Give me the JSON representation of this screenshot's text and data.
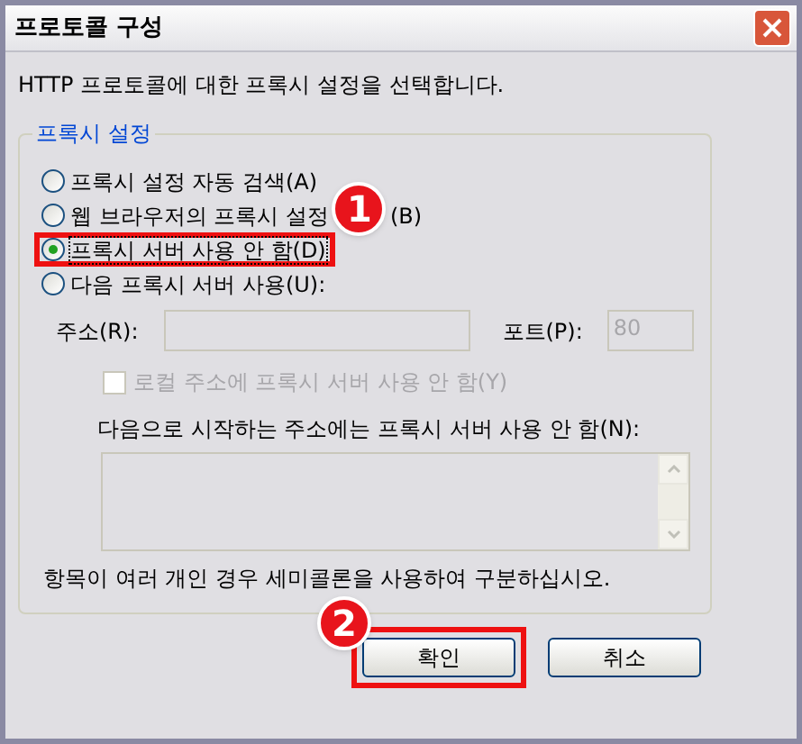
{
  "window": {
    "title": "프로토콜 구성"
  },
  "description": "HTTP 프로토콜에 대한 프록시 설정을 선택합니다.",
  "group": {
    "title": "프록시 설정",
    "options": [
      {
        "label": "프록시 설정 자동 검색(A)",
        "selected": false,
        "highlighted": false
      },
      {
        "label": "웹 브라우저의 프록시 설정",
        "suffix": "(B)",
        "badge": "1",
        "selected": false,
        "highlighted": false
      },
      {
        "label": "프록시 서버 사용 안 함(D)",
        "selected": true,
        "highlighted": true
      },
      {
        "label": "다음 프록시 서버 사용(U):",
        "selected": false,
        "highlighted": false
      }
    ],
    "address": {
      "label": "주소(R):",
      "disabled": true
    },
    "port": {
      "label": "포트(P):",
      "value": "80",
      "disabled": true
    },
    "bypass_local": {
      "label": "로컬 주소에 프록시 서버 사용 안 함(Y)",
      "checked": false,
      "disabled": true
    },
    "exceptions": {
      "label": "다음으로 시작하는 주소에는 프록시 서버 사용 안 함(N):",
      "disabled": true
    },
    "note": "항목이 여러 개인 경우 세미콜론을 사용하여 구분하십시오."
  },
  "buttons": [
    {
      "label": "확인",
      "highlighted": true,
      "badge": "2"
    },
    {
      "label": "취소",
      "highlighted": false
    }
  ]
}
